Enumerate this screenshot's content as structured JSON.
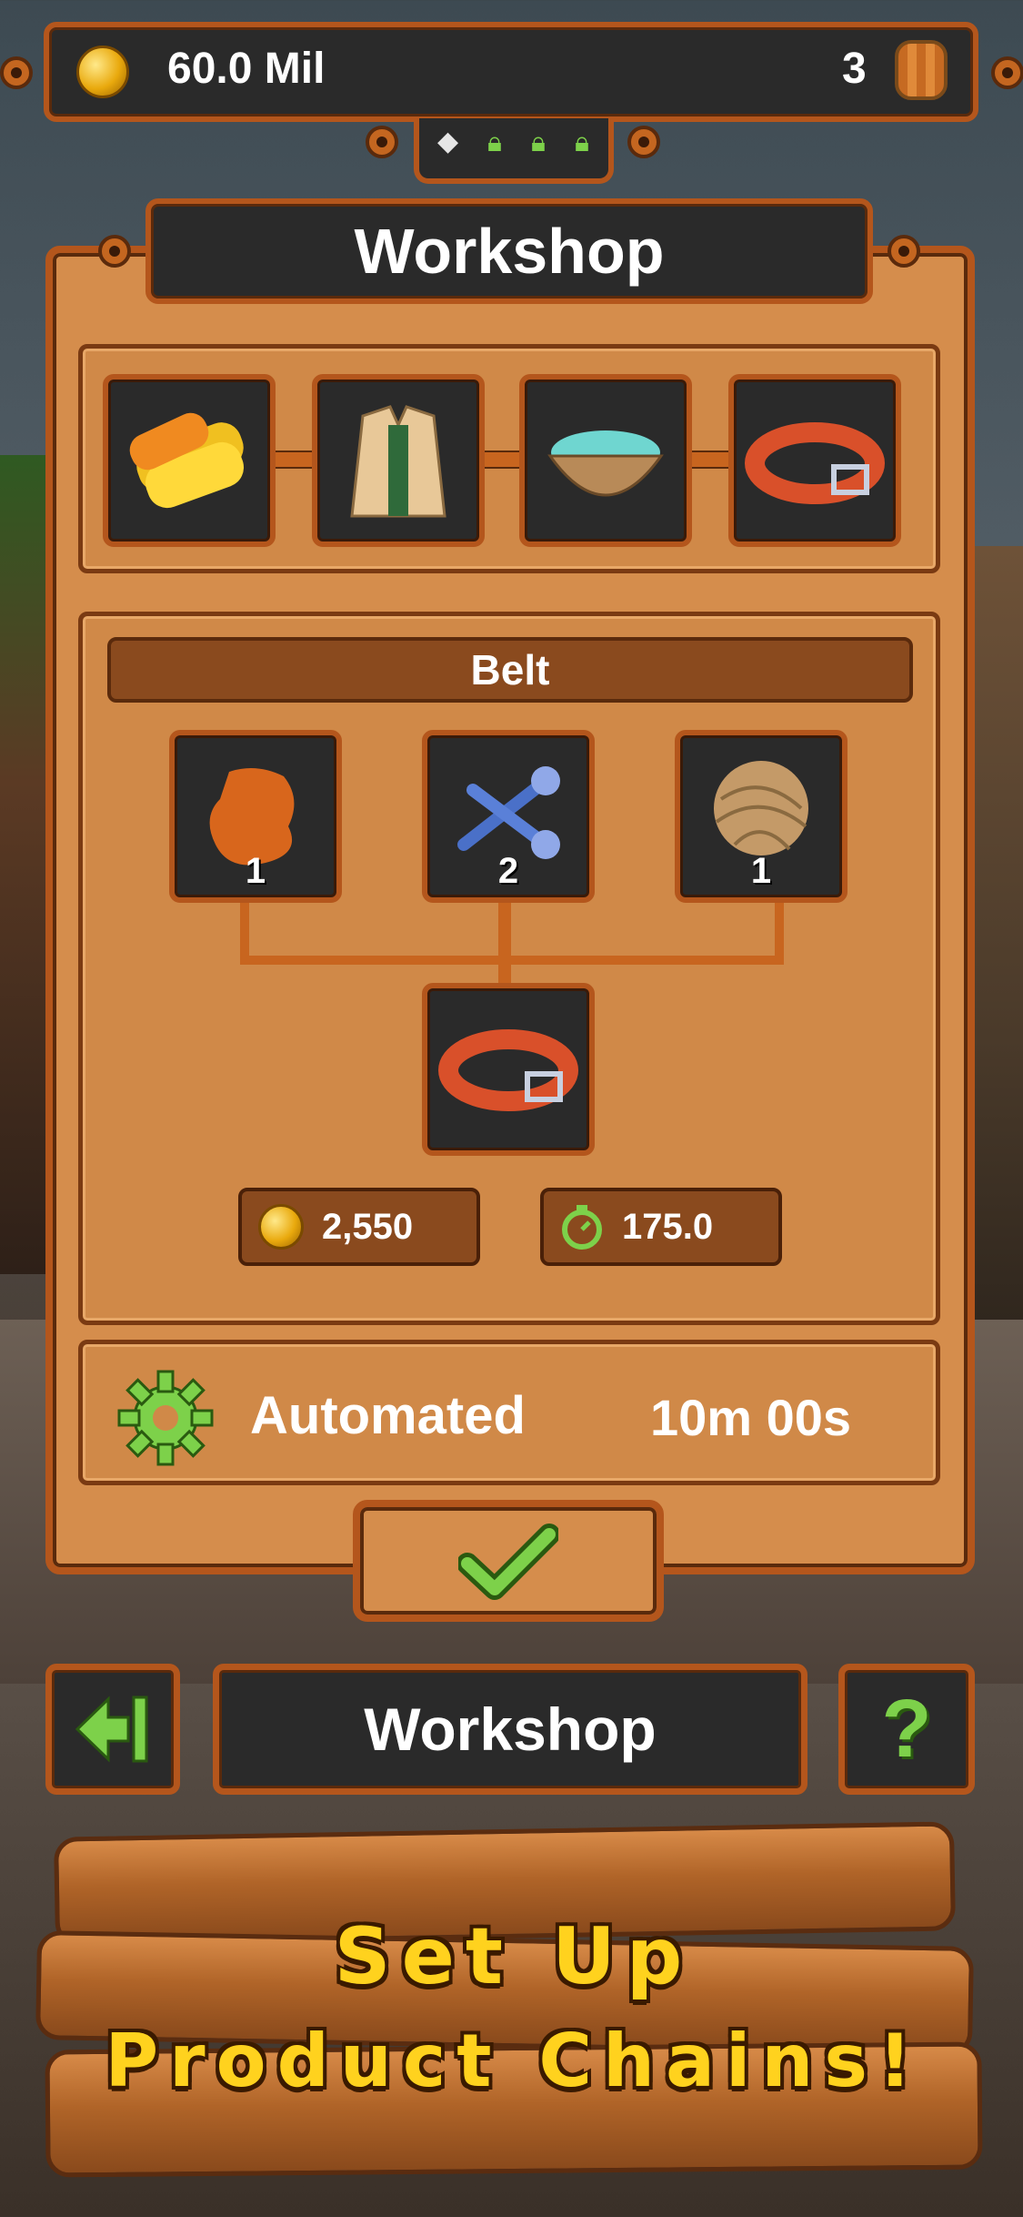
{
  "header": {
    "coins": "60.0 Mil",
    "barrels": "3"
  },
  "panel": {
    "title": "Workshop",
    "chain_items": [
      "fabric-rolls-icon",
      "jacket-icon",
      "gem-bowl-icon",
      "belt-icon"
    ],
    "recipe": {
      "name": "Belt",
      "ingredients": [
        {
          "icon": "leather-icon",
          "qty": "1"
        },
        {
          "icon": "nails-icon",
          "qty": "2"
        },
        {
          "icon": "yarn-ball-icon",
          "qty": "1"
        }
      ],
      "output_icon": "belt-icon",
      "price": "2,550",
      "time": "175.0"
    },
    "automation": {
      "label": "Automated",
      "duration": "10m 00s"
    }
  },
  "bottom_bar": {
    "title": "Workshop",
    "help_label": "?"
  },
  "promo": {
    "line1": "Set Up",
    "line2": "Product Chains!"
  },
  "colors": {
    "frame": "#b4561c",
    "panel": "#d58d4c",
    "accent_green": "#7dd14a",
    "promo_text": "#ffd21e"
  }
}
